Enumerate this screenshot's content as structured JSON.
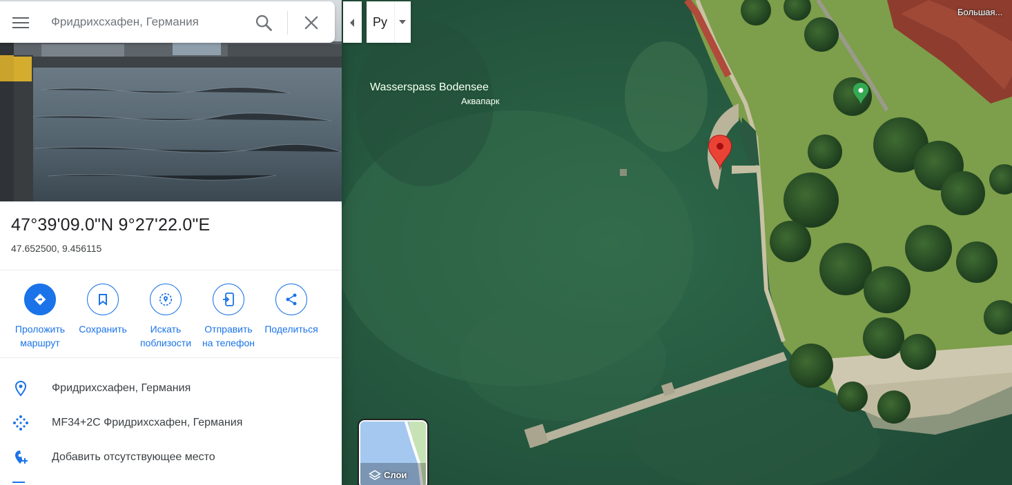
{
  "search": {
    "placeholder": "Фридрихсхафен, Германия"
  },
  "language_button": {
    "label": "Ру"
  },
  "place": {
    "title": "47°39'09.0\"N 9°27'22.0\"E",
    "decimal": "47.652500, 9.456115"
  },
  "actions": [
    {
      "label": "Проложить\nмаршрут",
      "icon": "directions-icon"
    },
    {
      "label": "Сохранить",
      "icon": "bookmark-icon"
    },
    {
      "label": "Искать\nпоблизости",
      "icon": "nearby-icon"
    },
    {
      "label": "Отправить\nна телефон",
      "icon": "send-to-phone-icon"
    },
    {
      "label": "Поделиться",
      "icon": "share-icon"
    }
  ],
  "info": [
    {
      "text": "Фридрихсхафен, Германия",
      "icon": "location-pin-icon"
    },
    {
      "text": "MF34+2C Фридрихсхафен, Германия",
      "icon": "plus-code-icon"
    },
    {
      "text": "Добавить отсутствующее место",
      "icon": "add-place-icon"
    }
  ],
  "map": {
    "poi": {
      "name": "Wasserspass Bodensee",
      "category": "Аквапарк"
    },
    "district": "Большая...",
    "layers_label": "Слои"
  },
  "colors": {
    "accent": "#1a73e8",
    "marker": "#ea4335",
    "poi_marker": "#34a853",
    "water": "#2b5a43",
    "grass": "#7fa34a"
  }
}
